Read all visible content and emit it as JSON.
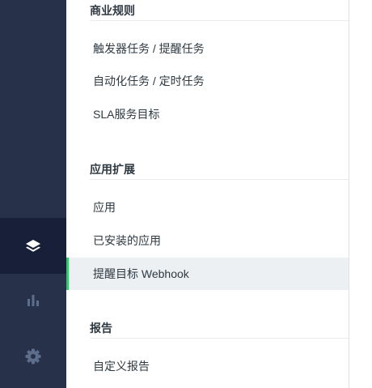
{
  "rail": {
    "items": [
      {
        "name": "layers-icon",
        "active": true
      },
      {
        "name": "bar-chart-icon",
        "active": false
      },
      {
        "name": "gear-icon",
        "active": false
      }
    ]
  },
  "sections": {
    "business_rules": {
      "title": "商业规则",
      "items": [
        "触发器任务 / 提醒任务",
        "自动化任务 / 定时任务",
        "SLA服务目标"
      ]
    },
    "app_extensions": {
      "title": "应用扩展",
      "items": [
        "应用",
        "已安装的应用",
        "提醒目标 Webhook"
      ]
    },
    "reports": {
      "title": "报告",
      "items": [
        "自定义报告"
      ]
    }
  },
  "colors": {
    "rail_bg": "#273149",
    "rail_active": "#182039",
    "active_indicator": "#3ec26f",
    "active_row_bg": "#edf0f2"
  }
}
